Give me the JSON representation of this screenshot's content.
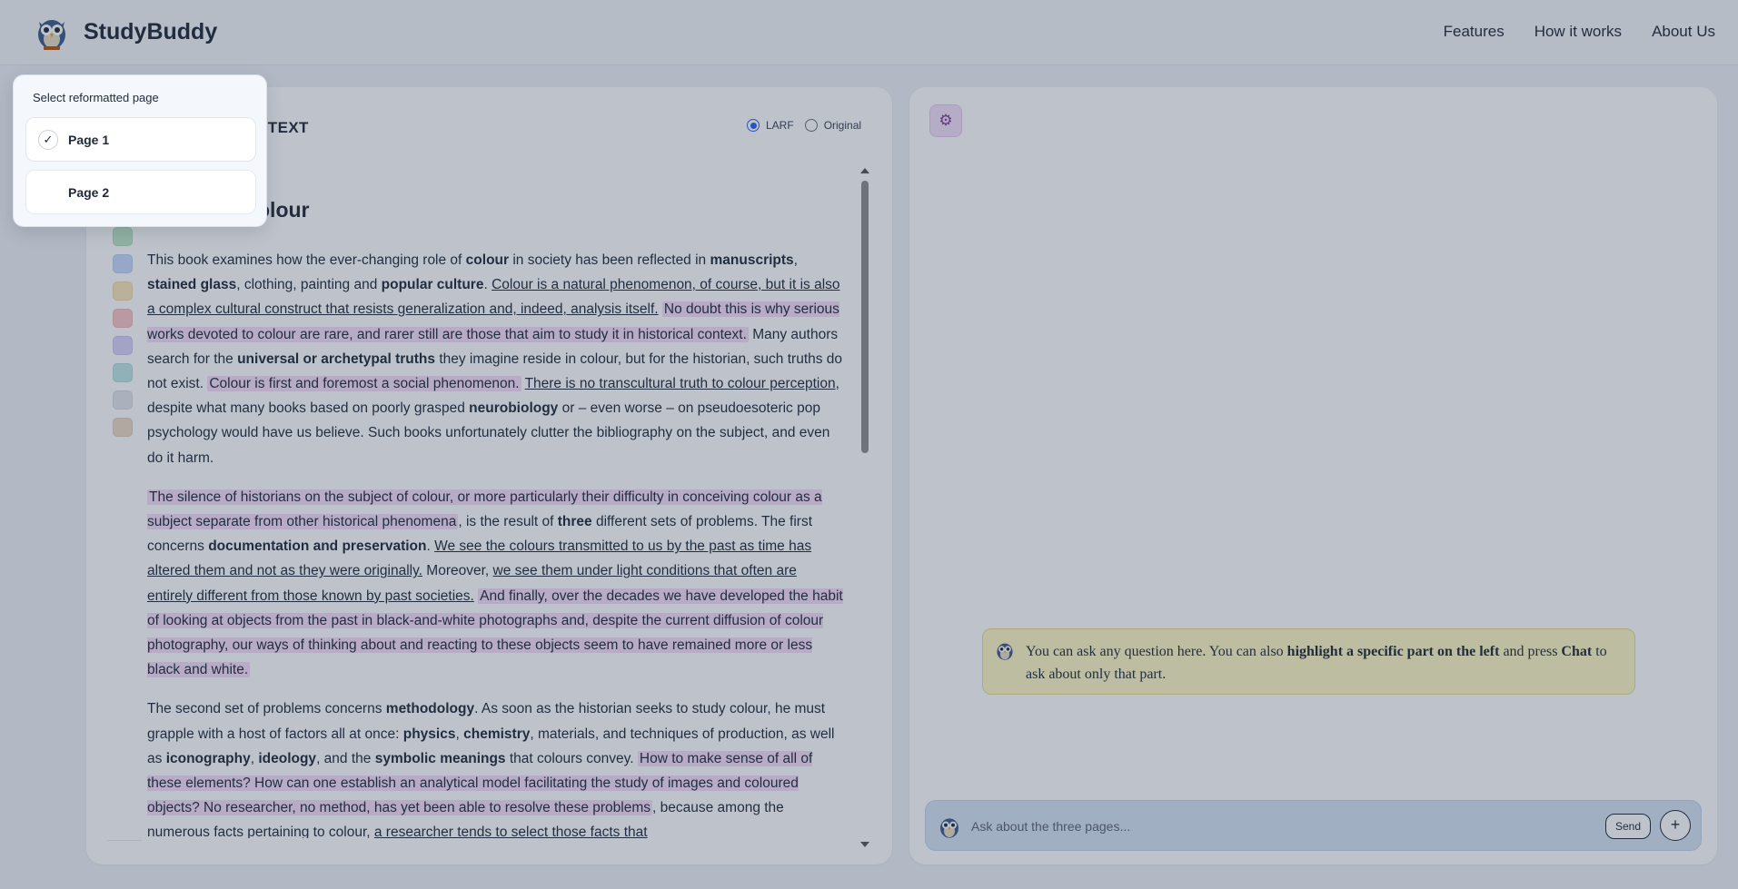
{
  "header": {
    "brand": "StudyBuddy",
    "nav": [
      "Features",
      "How it works",
      "About Us"
    ]
  },
  "left_panel": {
    "title": "D TEXT",
    "view_options": [
      {
        "label": "LARF",
        "selected": true
      },
      {
        "label": "Original",
        "selected": false
      }
    ],
    "heading": "olour",
    "swatch_colors": [
      "#bfe7c9",
      "#c6d8fb",
      "#fbe4b6",
      "#f8c4c4",
      "#d9d0fa",
      "#bfe4e4",
      "#e3e6ea",
      "#eed9c4"
    ]
  },
  "popup": {
    "title": "Select reformatted page",
    "pages": [
      {
        "label": "Page 1",
        "selected": true,
        "check": "✓"
      },
      {
        "label": "Page 2",
        "selected": false,
        "check": ""
      }
    ]
  },
  "right_panel": {
    "settings_icon": "gear-icon",
    "message": {
      "t1": "You can ask any question here. You can also ",
      "b1": "highlight a specific part on the left",
      "t2": " and press ",
      "b2": "Chat",
      "t3": " to ask about only that part."
    },
    "input": {
      "placeholder": "Ask about the three pages...",
      "send_label": "Send",
      "plus_label": "+"
    }
  },
  "content": {
    "paragraphs": [
      [
        {
          "t": "This book examines how the ever-changing role of "
        },
        {
          "t": "colour",
          "b": true
        },
        {
          "t": " in society has been reflected in "
        },
        {
          "t": "manuscripts",
          "b": true
        },
        {
          "t": ", "
        },
        {
          "t": "stained glass",
          "b": true
        },
        {
          "t": ", clothing, painting and "
        },
        {
          "t": "popular culture",
          "b": true
        },
        {
          "t": ". "
        },
        {
          "t": "Colour is a natural phenomenon, of course, but it is also a complex cultural construct that resists generalization and, indeed, analysis itself.",
          "u": true
        },
        {
          "t": " "
        },
        {
          "t": "No doubt this is why serious works devoted to colour are rare, and rarer still are those that aim to study it in historical context.",
          "h": true
        },
        {
          "t": " Many authors search for the "
        },
        {
          "t": "universal or archetypal truths",
          "b": true
        },
        {
          "t": " they imagine reside in colour, but for the historian, such truths do not exist. "
        },
        {
          "t": "Colour is first and foremost a social phenomenon.",
          "h": true
        },
        {
          "t": " "
        },
        {
          "t": "There is no transcultural truth to colour perception",
          "u": true
        },
        {
          "t": ", despite what many books based on poorly grasped "
        },
        {
          "t": "neurobiology",
          "b": true
        },
        {
          "t": " or – even worse – on pseudoesoteric pop psychology would have us believe. Such books unfortunately clutter the bibliography on the subject, and even do it harm."
        }
      ],
      [
        {
          "t": "The silence of historians on the subject of colour, or more particularly their difficulty in conceiving colour as a subject separate from other historical phenomena",
          "h": true
        },
        {
          "t": ", is the result of "
        },
        {
          "t": "three",
          "b": true
        },
        {
          "t": " different sets of problems. The first concerns "
        },
        {
          "t": "documentation and preservation",
          "b": true
        },
        {
          "t": ". "
        },
        {
          "t": "We see the colours transmitted to us by the past as time has altered them and not as they were originally.",
          "u": true
        },
        {
          "t": " Moreover, "
        },
        {
          "t": "we see them under light conditions that often are entirely different from those known by past societies.",
          "u": true
        },
        {
          "t": " "
        },
        {
          "t": "And finally, over the decades we have developed the habit of looking at objects from the past in black-and-white photographs and, despite the current diffusion of colour photography, our ways of thinking about and reacting to these objects seem to have remained more or less black and white.",
          "h": true
        }
      ],
      [
        {
          "t": "The second set of problems concerns "
        },
        {
          "t": "methodology",
          "b": true
        },
        {
          "t": ". As soon as the historian seeks to study colour, he must grapple with a host of factors all at once: "
        },
        {
          "t": "physics",
          "b": true
        },
        {
          "t": ", "
        },
        {
          "t": "chemistry",
          "b": true
        },
        {
          "t": ", materials, and techniques of production, as well as "
        },
        {
          "t": "iconography",
          "b": true
        },
        {
          "t": ", "
        },
        {
          "t": "ideology",
          "b": true
        },
        {
          "t": ", and the "
        },
        {
          "t": "symbolic meanings",
          "b": true
        },
        {
          "t": " that colours convey. "
        },
        {
          "t": "How to make sense of all of these elements? How can one establish an analytical model facilitating the study of images and coloured objects? No researcher, no method, has yet been able to resolve these problems",
          "h": true
        },
        {
          "t": ", because among the numerous facts pertaining to colour, "
        },
        {
          "t": "a researcher tends to select those facts that",
          "u": true
        }
      ]
    ]
  }
}
